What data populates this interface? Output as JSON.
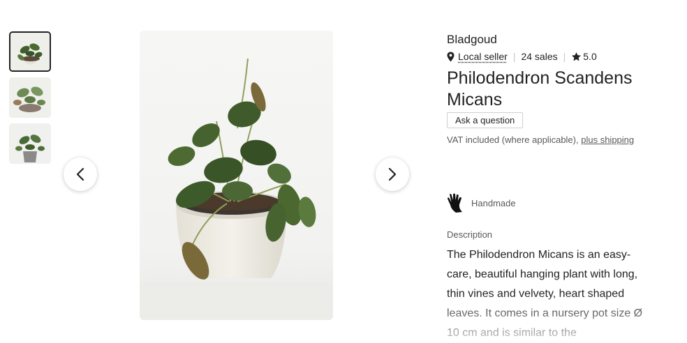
{
  "gallery": {
    "thumbnails": [
      "plant-photo-1",
      "plant-photo-2",
      "plant-photo-3"
    ],
    "active_index": 0,
    "prev_icon": "chevron-left-icon",
    "next_icon": "chevron-right-icon"
  },
  "shop": {
    "name": "Bladgoud",
    "location_icon": "location-pin-icon",
    "local_label": "Local seller",
    "sales": "24 sales",
    "star_icon": "star-icon",
    "rating": "5.0"
  },
  "product": {
    "title": "Philodendron Scandens Micans",
    "ask_label": "Ask a question",
    "vat_text": "VAT included (where applicable),",
    "shipping_link": "plus shipping"
  },
  "highlights": {
    "handmade_icon": "hand-icon",
    "handmade_label": "Handmade"
  },
  "description": {
    "label": "Description",
    "text": "The Philodendron Micans is an easy-care, beautiful hanging plant with long, thin vines and velvety, heart shaped leaves. It comes in a nursery pot size Ø 10 cm and is similar to the"
  },
  "colors": {
    "text": "#222222",
    "muted": "#595959",
    "leaf": "#3d5a2a"
  }
}
